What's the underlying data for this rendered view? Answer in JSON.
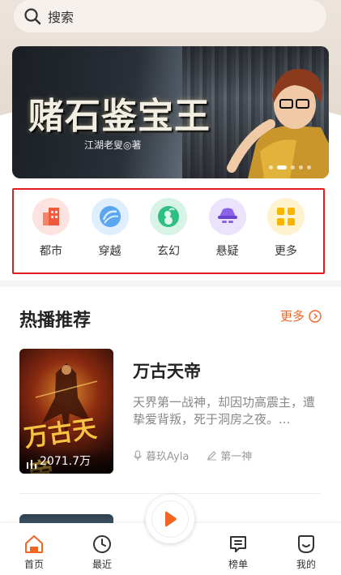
{
  "search": {
    "placeholder": "搜索"
  },
  "banner": {
    "title": "赌石鉴宝王",
    "author": "江湖老叟◎著",
    "slides": 5,
    "active_slide": 1
  },
  "categories": [
    {
      "label": "都市",
      "icon": "city-building-icon",
      "color": "#fde3e0"
    },
    {
      "label": "穿越",
      "icon": "portal-swirl-icon",
      "color": "#dfeefd"
    },
    {
      "label": "玄幻",
      "icon": "magic-gourd-icon",
      "color": "#d8f4e6"
    },
    {
      "label": "悬疑",
      "icon": "detective-hat-icon",
      "color": "#ebe3fb"
    },
    {
      "label": "更多",
      "icon": "more-grid-icon",
      "color": "#fff3cf"
    }
  ],
  "section": {
    "title": "热播推荐",
    "more_label": "更多"
  },
  "books": [
    {
      "title": "万古天帝",
      "description": "天界第一战神，却因功高震主，遭挚爱背叛，死于洞房之夜。...",
      "plays": "2071.7万",
      "narrator": "暮玖Ayla",
      "author": "第一神",
      "cover_text": "万古天帝"
    }
  ],
  "tabbar": {
    "home": "首页",
    "recent": "最近",
    "rank": "榜单",
    "mine": "我的"
  },
  "colors": {
    "accent": "#f06524",
    "highlight_border": "#e01e1e"
  }
}
